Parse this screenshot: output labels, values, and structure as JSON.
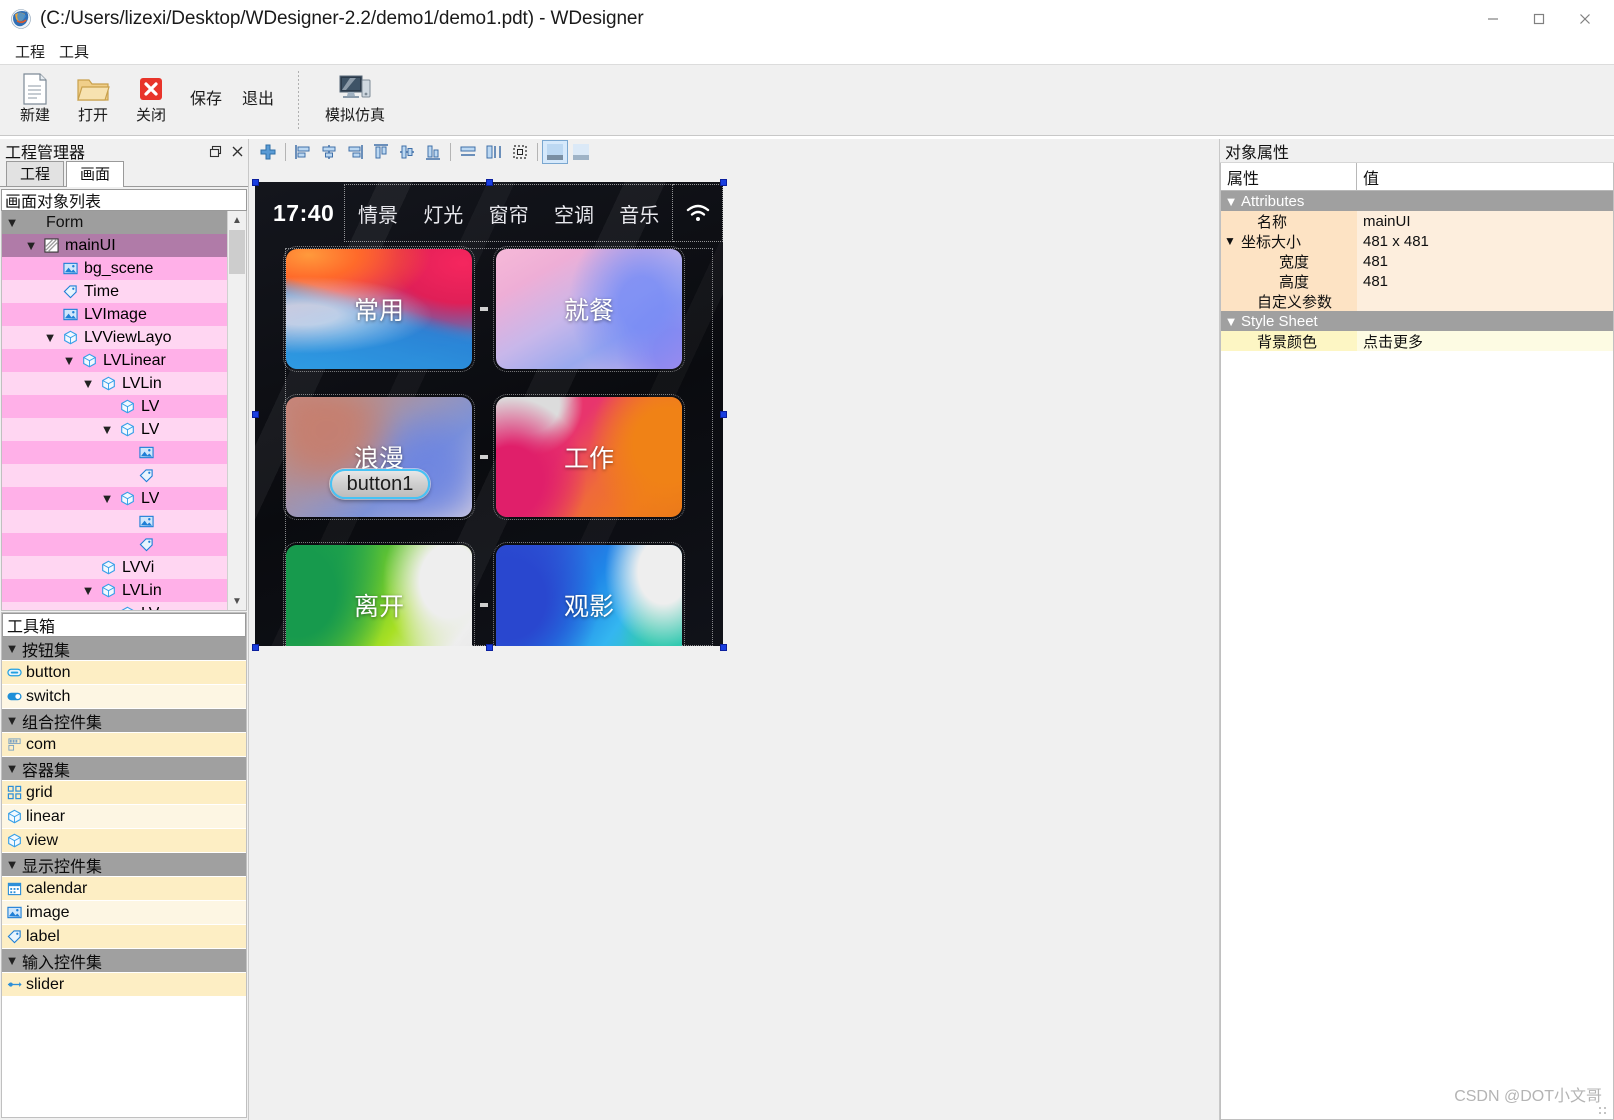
{
  "window": {
    "title": "(C:/Users/lizexi/Desktop/WDesigner-2.2/demo1/demo1.pdt) - WDesigner",
    "minimize": "—",
    "maximize": "□",
    "close": "✕"
  },
  "menubar": {
    "items": [
      {
        "label": "工程"
      },
      {
        "label": "工具"
      }
    ]
  },
  "ribbon": {
    "buttons": [
      {
        "label": "新建",
        "icon": "new-document-icon"
      },
      {
        "label": "打开",
        "icon": "open-folder-icon"
      },
      {
        "label": "关闭",
        "icon": "close-red-x-icon"
      }
    ],
    "text_buttons": [
      {
        "label": "保存"
      },
      {
        "label": "退出"
      }
    ],
    "simulate": {
      "label": "模拟仿真",
      "icon": "monitor-simulate-icon"
    }
  },
  "project_manager": {
    "title": "工程管理器",
    "float_button": "restore-icon",
    "close_button": "close-icon",
    "tabs": [
      {
        "label": "工程",
        "active": false
      },
      {
        "label": "画面",
        "active": true
      }
    ],
    "list_caption": "画面对象列表",
    "tree": [
      {
        "label": "Form",
        "depth": 0,
        "chevron": "▼",
        "icon": "none",
        "style": "form"
      },
      {
        "label": "mainUI",
        "depth": 1,
        "chevron": "▼",
        "icon": "hatch",
        "style": "sel"
      },
      {
        "label": "bg_scene",
        "depth": 2,
        "chevron": "",
        "icon": "image",
        "style": "pinkA"
      },
      {
        "label": "Time",
        "depth": 2,
        "chevron": "",
        "icon": "label",
        "style": "pinkB"
      },
      {
        "label": "LVImage",
        "depth": 2,
        "chevron": "",
        "icon": "image",
        "style": "pinkA"
      },
      {
        "label": "LVViewLayo",
        "depth": 2,
        "chevron": "▼",
        "icon": "cube",
        "style": "pinkB"
      },
      {
        "label": "LVLinear",
        "depth": 3,
        "chevron": "▼",
        "icon": "cube",
        "style": "pinkA"
      },
      {
        "label": "LVLin",
        "depth": 4,
        "chevron": "▼",
        "icon": "cube",
        "style": "pinkB"
      },
      {
        "label": "LV",
        "depth": 5,
        "chevron": "",
        "icon": "cube",
        "style": "pinkA"
      },
      {
        "label": "LV",
        "depth": 5,
        "chevron": "▼",
        "icon": "cube",
        "style": "pinkB"
      },
      {
        "label": "",
        "depth": 6,
        "chevron": "",
        "icon": "image",
        "style": "pinkA"
      },
      {
        "label": "",
        "depth": 6,
        "chevron": "",
        "icon": "label",
        "style": "pinkB"
      },
      {
        "label": "LV",
        "depth": 5,
        "chevron": "▼",
        "icon": "cube",
        "style": "pinkA"
      },
      {
        "label": "",
        "depth": 6,
        "chevron": "",
        "icon": "image",
        "style": "pinkB"
      },
      {
        "label": "",
        "depth": 6,
        "chevron": "",
        "icon": "label",
        "style": "pinkA"
      },
      {
        "label": "LVVi",
        "depth": 4,
        "chevron": "",
        "icon": "cube",
        "style": "pinkB"
      },
      {
        "label": "LVLin",
        "depth": 4,
        "chevron": "▼",
        "icon": "cube",
        "style": "pinkA"
      },
      {
        "label": "LV",
        "depth": 5,
        "chevron": "▼",
        "icon": "cube",
        "style": "pinkB"
      }
    ]
  },
  "toolbox": {
    "caption": "工具箱",
    "sections": [
      {
        "label": "按钮集",
        "chevron": "▼",
        "items": [
          {
            "label": "button",
            "icon": "button-icon"
          },
          {
            "label": "switch",
            "icon": "switch-icon"
          }
        ]
      },
      {
        "label": "组合控件集",
        "chevron": "▼",
        "items": [
          {
            "label": "com",
            "icon": "component-icon"
          }
        ]
      },
      {
        "label": "容器集",
        "chevron": "▼",
        "items": [
          {
            "label": "grid",
            "icon": "grid-icon"
          },
          {
            "label": "linear",
            "icon": "cube-icon"
          },
          {
            "label": "view",
            "icon": "cube-icon"
          }
        ]
      },
      {
        "label": "显示控件集",
        "chevron": "▼",
        "items": [
          {
            "label": "calendar",
            "icon": "calendar-icon"
          },
          {
            "label": "image",
            "icon": "image-icon"
          },
          {
            "label": "label",
            "icon": "label-icon"
          }
        ]
      },
      {
        "label": "输入控件集",
        "chevron": "▼",
        "items": [
          {
            "label": "slider",
            "icon": "slider-icon"
          }
        ]
      }
    ]
  },
  "canvas_toolbar": {
    "buttons": [
      {
        "icon": "add-plus-icon",
        "name": "add-widget-button",
        "selected": false
      },
      {
        "icon": "align-left-icon",
        "name": "align-left-button",
        "selected": false
      },
      {
        "icon": "align-center-h-icon",
        "name": "align-center-h-button",
        "selected": false
      },
      {
        "icon": "align-right-icon",
        "name": "align-right-button",
        "selected": false
      },
      {
        "icon": "align-top-icon",
        "name": "align-top-button",
        "selected": false
      },
      {
        "icon": "align-middle-v-icon",
        "name": "align-middle-v-button",
        "selected": false
      },
      {
        "icon": "align-bottom-icon",
        "name": "align-bottom-button",
        "selected": false
      },
      {
        "icon": "distribute-h-icon",
        "name": "distribute-h-button",
        "selected": false
      },
      {
        "icon": "distribute-v-icon",
        "name": "distribute-v-button",
        "selected": false
      },
      {
        "icon": "fit-selection-icon",
        "name": "fit-selection-button",
        "selected": false
      },
      {
        "icon": "grid-snap-icon",
        "name": "grid-snap-toggle",
        "selected": true
      },
      {
        "icon": "grid-show-icon",
        "name": "grid-show-toggle",
        "selected": false
      }
    ]
  },
  "design_preview": {
    "clock": "17:40",
    "nav_tabs": [
      "情景",
      "灯光",
      "窗帘",
      "空调",
      "音乐"
    ],
    "wifi_icon": "wifi-icon",
    "cards": [
      {
        "label": "常用",
        "theme": "c-chang"
      },
      {
        "label": "就餐",
        "theme": "c-jiu"
      },
      {
        "label": "浪漫",
        "theme": "c-lang"
      },
      {
        "label": "工作",
        "theme": "c-gong"
      },
      {
        "label": "离开",
        "theme": "c-li"
      },
      {
        "label": "观影",
        "theme": "c-guan"
      }
    ],
    "selected_widget": {
      "label": "button1"
    }
  },
  "properties": {
    "title": "对象属性",
    "header": {
      "name_col": "属性",
      "value_col": "值"
    },
    "groups": [
      {
        "label": "Attributes",
        "chevron": "▼",
        "rows": [
          {
            "name": "名称",
            "value": "mainUI",
            "indent": 1,
            "chevron": "",
            "highlight": "orange"
          },
          {
            "name": "坐标大小",
            "value": "481 x 481",
            "indent": 0,
            "chevron": "▼",
            "highlight": "orange"
          },
          {
            "name": "宽度",
            "value": "481",
            "indent": 2,
            "chevron": "",
            "highlight": "orange"
          },
          {
            "name": "高度",
            "value": "481",
            "indent": 2,
            "chevron": "",
            "highlight": "orange"
          },
          {
            "name": "自定义参数",
            "value": "",
            "indent": 1,
            "chevron": "",
            "highlight": "orange"
          }
        ]
      },
      {
        "label": "Style Sheet",
        "chevron": "▼",
        "rows": [
          {
            "name": "背景颜色",
            "value": "点击更多",
            "indent": 1,
            "chevron": "",
            "highlight": "yellow"
          }
        ]
      }
    ]
  },
  "watermark": {
    "text": "CSDN @DOT小文哥"
  },
  "colors": {
    "selection_blue": "#1a3fe0",
    "tree_selected": "#b07ba8",
    "tree_pink_a": "#ffb0e8",
    "tree_pink_b": "#ffd6f2",
    "toolbox_group": "#a0a0a0",
    "toolbox_item": "#fdeec4",
    "prop_orange": "#fde3c4",
    "prop_yellow": "#fdf6c4",
    "chrome": "#f0f0f0"
  }
}
